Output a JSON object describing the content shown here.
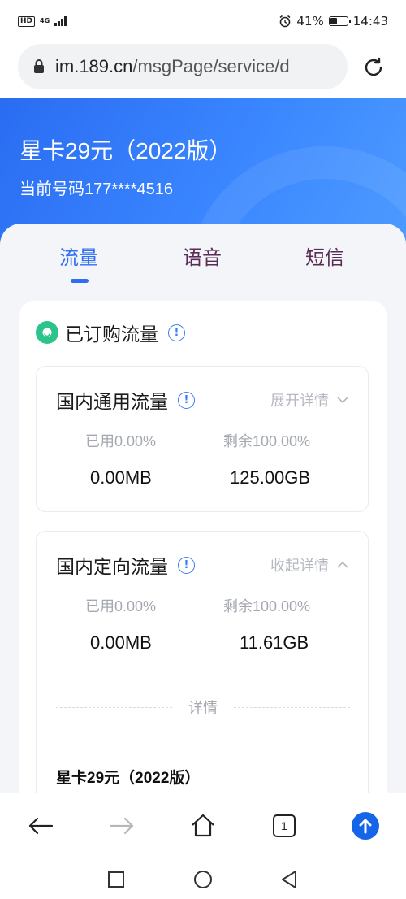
{
  "status_bar": {
    "hd": "HD",
    "network": "4G",
    "battery_percent": "41%",
    "battery_level": 0.41,
    "time": "14:43"
  },
  "address_bar": {
    "url_host": "im.189.cn",
    "url_path": "/msgPage/service/d"
  },
  "hero": {
    "plan_title": "星卡29元（2022版）",
    "phone_number": "当前号码177****4516"
  },
  "tabs": [
    {
      "label": "流量",
      "active": true
    },
    {
      "label": "语音",
      "active": false
    },
    {
      "label": "短信",
      "active": false
    }
  ],
  "subscribed": {
    "title": "已订购流量",
    "info_glyph": "!"
  },
  "general": {
    "title": "国内通用流量",
    "toggle_label": "展开详情",
    "used_label": "已用0.00%",
    "remaining_label": "剩余100.00%",
    "used_value": "0.00MB",
    "remaining_value": "125.00GB"
  },
  "directed": {
    "title": "国内定向流量",
    "toggle_label": "收起详情",
    "used_label": "已用0.00%",
    "remaining_label": "剩余100.00%",
    "used_value": "0.00MB",
    "remaining_value": "11.61GB",
    "detail_label": "详情",
    "detail_plan": "星卡29元（2022版）"
  },
  "toolbar": {
    "tab_count": "1"
  },
  "colors": {
    "accent": "#2f6ef0",
    "hero_blue": "#3a86ff",
    "inactive_tab": "#5a2b55",
    "green": "#2bc48a"
  }
}
